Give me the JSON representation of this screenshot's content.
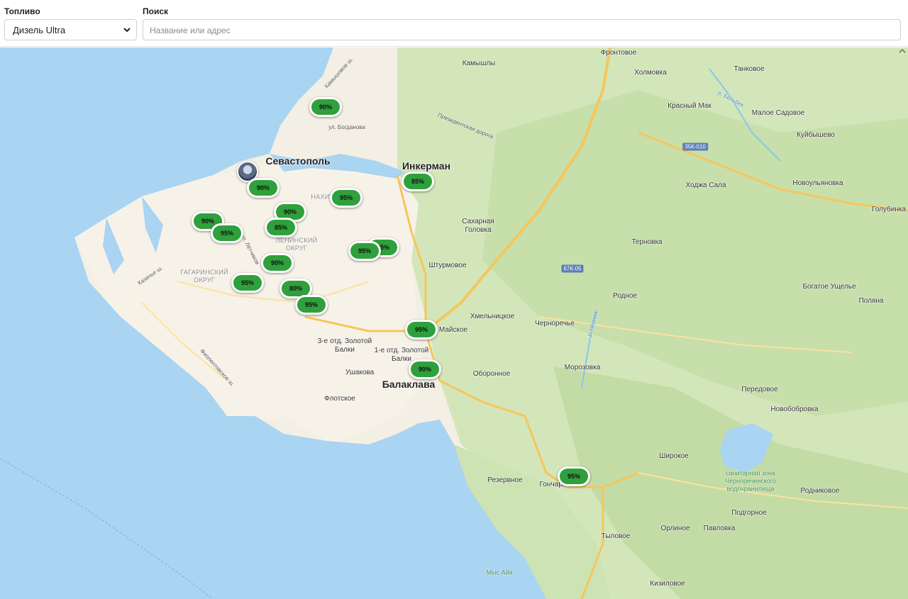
{
  "filters": {
    "fuel_label": "Топливо",
    "fuel_value": "Дизель Ultra",
    "search_label": "Поиск",
    "search_placeholder": "Название или адрес"
  },
  "colors": {
    "pin_green": "#2fa03c",
    "sea": "#a9d4f2",
    "land": "#f3efe4",
    "forest": "#cfe3b5",
    "road": "#f6c65b"
  },
  "map": {
    "cities": [
      "Севастополь",
      "Инкерман",
      "Балаклава"
    ],
    "places": [
      "Фронтовое",
      "Камышлы",
      "Холмовка",
      "Танковое",
      "Красный Мак",
      "Малое Садовое",
      "Куйбышево",
      "Ходжа Сала",
      "Новоульяновка",
      "Голубинка",
      "Сахарная Головка",
      "Терновка",
      "Штурмовое",
      "Родное",
      "Богатое Ущелье",
      "Поляна",
      "Хмельницкое",
      "Черноречье",
      "Морозовка",
      "Оборонное",
      "Передовое",
      "Новобобровка",
      "Резервное",
      "Гончарное",
      "Широкое",
      "Родниковое",
      "Подгорное",
      "Орлиное",
      "Павловка",
      "Тыловое",
      "Кизиловое",
      "Майское",
      "Ушакова",
      "Флотское",
      "3-е отд. Золотой Балки",
      "1-е отд. Золотой Балки",
      "Мыс Айя",
      "санитарная зона Чернореченского водохранилища"
    ],
    "districts": [
      "ЛЕНИНСКИЙ ОКРУГ",
      "ГАГАРИНСКИЙ ОКРУГ",
      "НАХИМОВСКИЙ"
    ],
    "streets": [
      "ул. Богданова",
      "Камышовое ш.",
      "Президентская дорога",
      "р. Бельбек",
      "р. Чёрная",
      "Казачье ш.",
      "Фиолентовское ш.",
      "ул. Лётчиков"
    ],
    "road_badges": [
      "35К-010",
      "67К-05"
    ],
    "pins": [
      "90%",
      "85%",
      "95%",
      "90%",
      "90%",
      "90%",
      "95%",
      "85%",
      "95%",
      "95%",
      "90%",
      "95%",
      "80%",
      "95%",
      "95%",
      "90%",
      "95%"
    ]
  }
}
